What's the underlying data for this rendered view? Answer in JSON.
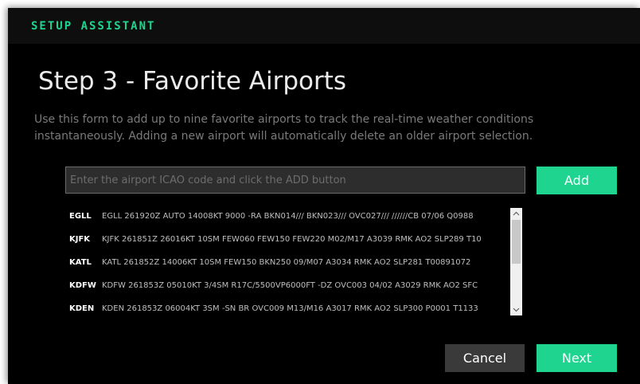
{
  "header": {
    "brand": "SETUP ASSISTANT"
  },
  "main": {
    "title": "Step 3 - Favorite Airports",
    "description_lines": [
      "Use this form to add up to nine favorite airports to track the real-time weather conditions",
      "instantaneously. Adding a new airport will automatically delete an older airport selection."
    ]
  },
  "form": {
    "input_value": "",
    "input_placeholder": "Enter the airport ICAO code and click the ADD button",
    "add_label": "Add"
  },
  "airports": [
    {
      "code": "EGLL",
      "metar": "EGLL 261920Z AUTO 14008KT 9000 -RA BKN014/// BKN023/// OVC027/// //////CB 07/06 Q0988"
    },
    {
      "code": "KJFK",
      "metar": "KJFK 261851Z 26016KT 10SM FEW060 FEW150 FEW220 M02/M17 A3039 RMK AO2 SLP289 T10"
    },
    {
      "code": "KATL",
      "metar": "KATL 261852Z 14006KT 10SM FEW150 BKN250 09/M07 A3034 RMK AO2 SLP281 T00891072"
    },
    {
      "code": "KDFW",
      "metar": "KDFW 261853Z 05010KT 3/4SM R17C/5500VP6000FT -DZ OVC003 04/02 A3029 RMK AO2 SFC"
    },
    {
      "code": "KDEN",
      "metar": "KDEN 261853Z 06004KT 3SM -SN BR OVC009 M13/M16 A3017 RMK AO2 SLP300 P0001 T1133"
    }
  ],
  "scrollbar": {
    "up_icon": "chevron-up-icon",
    "down_icon": "chevron-down-icon"
  },
  "footer": {
    "cancel_label": "Cancel",
    "next_label": "Next"
  },
  "colors": {
    "accent": "#1ed48f",
    "background": "#000000",
    "muted_text": "#7a7a7a"
  }
}
